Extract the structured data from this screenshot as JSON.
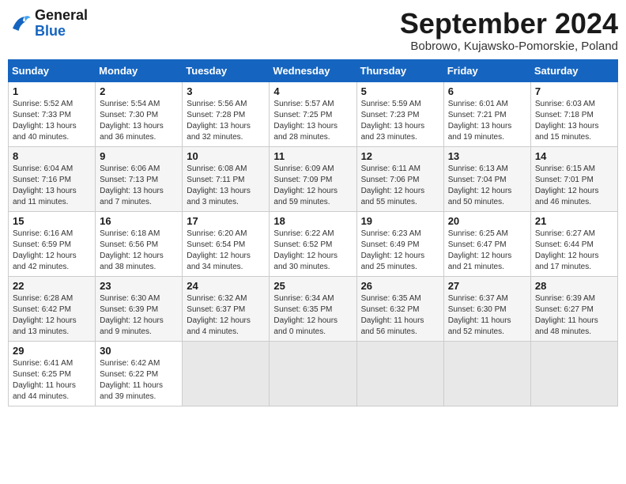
{
  "logo": {
    "line1": "General",
    "line2": "Blue"
  },
  "title": "September 2024",
  "location": "Bobrowo, Kujawsko-Pomorskie, Poland",
  "weekdays": [
    "Sunday",
    "Monday",
    "Tuesday",
    "Wednesday",
    "Thursday",
    "Friday",
    "Saturday"
  ],
  "weeks": [
    [
      {
        "day": "1",
        "info": "Sunrise: 5:52 AM\nSunset: 7:33 PM\nDaylight: 13 hours\nand 40 minutes."
      },
      {
        "day": "2",
        "info": "Sunrise: 5:54 AM\nSunset: 7:30 PM\nDaylight: 13 hours\nand 36 minutes."
      },
      {
        "day": "3",
        "info": "Sunrise: 5:56 AM\nSunset: 7:28 PM\nDaylight: 13 hours\nand 32 minutes."
      },
      {
        "day": "4",
        "info": "Sunrise: 5:57 AM\nSunset: 7:25 PM\nDaylight: 13 hours\nand 28 minutes."
      },
      {
        "day": "5",
        "info": "Sunrise: 5:59 AM\nSunset: 7:23 PM\nDaylight: 13 hours\nand 23 minutes."
      },
      {
        "day": "6",
        "info": "Sunrise: 6:01 AM\nSunset: 7:21 PM\nDaylight: 13 hours\nand 19 minutes."
      },
      {
        "day": "7",
        "info": "Sunrise: 6:03 AM\nSunset: 7:18 PM\nDaylight: 13 hours\nand 15 minutes."
      }
    ],
    [
      {
        "day": "8",
        "info": "Sunrise: 6:04 AM\nSunset: 7:16 PM\nDaylight: 13 hours\nand 11 minutes."
      },
      {
        "day": "9",
        "info": "Sunrise: 6:06 AM\nSunset: 7:13 PM\nDaylight: 13 hours\nand 7 minutes."
      },
      {
        "day": "10",
        "info": "Sunrise: 6:08 AM\nSunset: 7:11 PM\nDaylight: 13 hours\nand 3 minutes."
      },
      {
        "day": "11",
        "info": "Sunrise: 6:09 AM\nSunset: 7:09 PM\nDaylight: 12 hours\nand 59 minutes."
      },
      {
        "day": "12",
        "info": "Sunrise: 6:11 AM\nSunset: 7:06 PM\nDaylight: 12 hours\nand 55 minutes."
      },
      {
        "day": "13",
        "info": "Sunrise: 6:13 AM\nSunset: 7:04 PM\nDaylight: 12 hours\nand 50 minutes."
      },
      {
        "day": "14",
        "info": "Sunrise: 6:15 AM\nSunset: 7:01 PM\nDaylight: 12 hours\nand 46 minutes."
      }
    ],
    [
      {
        "day": "15",
        "info": "Sunrise: 6:16 AM\nSunset: 6:59 PM\nDaylight: 12 hours\nand 42 minutes."
      },
      {
        "day": "16",
        "info": "Sunrise: 6:18 AM\nSunset: 6:56 PM\nDaylight: 12 hours\nand 38 minutes."
      },
      {
        "day": "17",
        "info": "Sunrise: 6:20 AM\nSunset: 6:54 PM\nDaylight: 12 hours\nand 34 minutes."
      },
      {
        "day": "18",
        "info": "Sunrise: 6:22 AM\nSunset: 6:52 PM\nDaylight: 12 hours\nand 30 minutes."
      },
      {
        "day": "19",
        "info": "Sunrise: 6:23 AM\nSunset: 6:49 PM\nDaylight: 12 hours\nand 25 minutes."
      },
      {
        "day": "20",
        "info": "Sunrise: 6:25 AM\nSunset: 6:47 PM\nDaylight: 12 hours\nand 21 minutes."
      },
      {
        "day": "21",
        "info": "Sunrise: 6:27 AM\nSunset: 6:44 PM\nDaylight: 12 hours\nand 17 minutes."
      }
    ],
    [
      {
        "day": "22",
        "info": "Sunrise: 6:28 AM\nSunset: 6:42 PM\nDaylight: 12 hours\nand 13 minutes."
      },
      {
        "day": "23",
        "info": "Sunrise: 6:30 AM\nSunset: 6:39 PM\nDaylight: 12 hours\nand 9 minutes."
      },
      {
        "day": "24",
        "info": "Sunrise: 6:32 AM\nSunset: 6:37 PM\nDaylight: 12 hours\nand 4 minutes."
      },
      {
        "day": "25",
        "info": "Sunrise: 6:34 AM\nSunset: 6:35 PM\nDaylight: 12 hours\nand 0 minutes."
      },
      {
        "day": "26",
        "info": "Sunrise: 6:35 AM\nSunset: 6:32 PM\nDaylight: 11 hours\nand 56 minutes."
      },
      {
        "day": "27",
        "info": "Sunrise: 6:37 AM\nSunset: 6:30 PM\nDaylight: 11 hours\nand 52 minutes."
      },
      {
        "day": "28",
        "info": "Sunrise: 6:39 AM\nSunset: 6:27 PM\nDaylight: 11 hours\nand 48 minutes."
      }
    ],
    [
      {
        "day": "29",
        "info": "Sunrise: 6:41 AM\nSunset: 6:25 PM\nDaylight: 11 hours\nand 44 minutes."
      },
      {
        "day": "30",
        "info": "Sunrise: 6:42 AM\nSunset: 6:22 PM\nDaylight: 11 hours\nand 39 minutes."
      },
      null,
      null,
      null,
      null,
      null
    ]
  ]
}
